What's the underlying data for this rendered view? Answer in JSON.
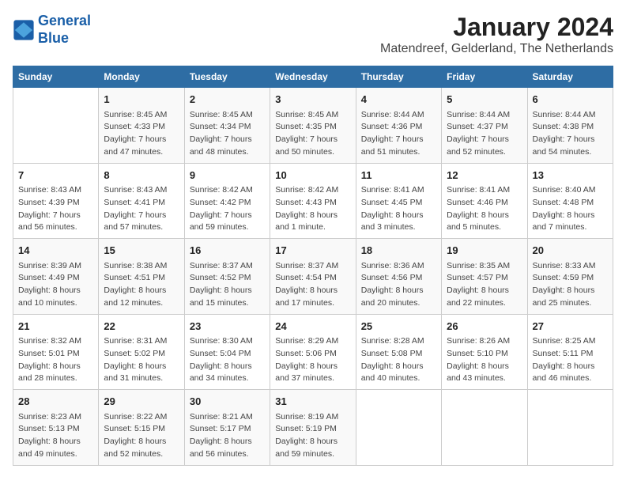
{
  "logo": {
    "line1": "General",
    "line2": "Blue"
  },
  "title": "January 2024",
  "subtitle": "Matendreef, Gelderland, The Netherlands",
  "days_of_week": [
    "Sunday",
    "Monday",
    "Tuesday",
    "Wednesday",
    "Thursday",
    "Friday",
    "Saturday"
  ],
  "weeks": [
    [
      {
        "day": "",
        "sunrise": "",
        "sunset": "",
        "daylight": ""
      },
      {
        "day": "1",
        "sunrise": "Sunrise: 8:45 AM",
        "sunset": "Sunset: 4:33 PM",
        "daylight": "Daylight: 7 hours and 47 minutes."
      },
      {
        "day": "2",
        "sunrise": "Sunrise: 8:45 AM",
        "sunset": "Sunset: 4:34 PM",
        "daylight": "Daylight: 7 hours and 48 minutes."
      },
      {
        "day": "3",
        "sunrise": "Sunrise: 8:45 AM",
        "sunset": "Sunset: 4:35 PM",
        "daylight": "Daylight: 7 hours and 50 minutes."
      },
      {
        "day": "4",
        "sunrise": "Sunrise: 8:44 AM",
        "sunset": "Sunset: 4:36 PM",
        "daylight": "Daylight: 7 hours and 51 minutes."
      },
      {
        "day": "5",
        "sunrise": "Sunrise: 8:44 AM",
        "sunset": "Sunset: 4:37 PM",
        "daylight": "Daylight: 7 hours and 52 minutes."
      },
      {
        "day": "6",
        "sunrise": "Sunrise: 8:44 AM",
        "sunset": "Sunset: 4:38 PM",
        "daylight": "Daylight: 7 hours and 54 minutes."
      }
    ],
    [
      {
        "day": "7",
        "sunrise": "Sunrise: 8:43 AM",
        "sunset": "Sunset: 4:39 PM",
        "daylight": "Daylight: 7 hours and 56 minutes."
      },
      {
        "day": "8",
        "sunrise": "Sunrise: 8:43 AM",
        "sunset": "Sunset: 4:41 PM",
        "daylight": "Daylight: 7 hours and 57 minutes."
      },
      {
        "day": "9",
        "sunrise": "Sunrise: 8:42 AM",
        "sunset": "Sunset: 4:42 PM",
        "daylight": "Daylight: 7 hours and 59 minutes."
      },
      {
        "day": "10",
        "sunrise": "Sunrise: 8:42 AM",
        "sunset": "Sunset: 4:43 PM",
        "daylight": "Daylight: 8 hours and 1 minute."
      },
      {
        "day": "11",
        "sunrise": "Sunrise: 8:41 AM",
        "sunset": "Sunset: 4:45 PM",
        "daylight": "Daylight: 8 hours and 3 minutes."
      },
      {
        "day": "12",
        "sunrise": "Sunrise: 8:41 AM",
        "sunset": "Sunset: 4:46 PM",
        "daylight": "Daylight: 8 hours and 5 minutes."
      },
      {
        "day": "13",
        "sunrise": "Sunrise: 8:40 AM",
        "sunset": "Sunset: 4:48 PM",
        "daylight": "Daylight: 8 hours and 7 minutes."
      }
    ],
    [
      {
        "day": "14",
        "sunrise": "Sunrise: 8:39 AM",
        "sunset": "Sunset: 4:49 PM",
        "daylight": "Daylight: 8 hours and 10 minutes."
      },
      {
        "day": "15",
        "sunrise": "Sunrise: 8:38 AM",
        "sunset": "Sunset: 4:51 PM",
        "daylight": "Daylight: 8 hours and 12 minutes."
      },
      {
        "day": "16",
        "sunrise": "Sunrise: 8:37 AM",
        "sunset": "Sunset: 4:52 PM",
        "daylight": "Daylight: 8 hours and 15 minutes."
      },
      {
        "day": "17",
        "sunrise": "Sunrise: 8:37 AM",
        "sunset": "Sunset: 4:54 PM",
        "daylight": "Daylight: 8 hours and 17 minutes."
      },
      {
        "day": "18",
        "sunrise": "Sunrise: 8:36 AM",
        "sunset": "Sunset: 4:56 PM",
        "daylight": "Daylight: 8 hours and 20 minutes."
      },
      {
        "day": "19",
        "sunrise": "Sunrise: 8:35 AM",
        "sunset": "Sunset: 4:57 PM",
        "daylight": "Daylight: 8 hours and 22 minutes."
      },
      {
        "day": "20",
        "sunrise": "Sunrise: 8:33 AM",
        "sunset": "Sunset: 4:59 PM",
        "daylight": "Daylight: 8 hours and 25 minutes."
      }
    ],
    [
      {
        "day": "21",
        "sunrise": "Sunrise: 8:32 AM",
        "sunset": "Sunset: 5:01 PM",
        "daylight": "Daylight: 8 hours and 28 minutes."
      },
      {
        "day": "22",
        "sunrise": "Sunrise: 8:31 AM",
        "sunset": "Sunset: 5:02 PM",
        "daylight": "Daylight: 8 hours and 31 minutes."
      },
      {
        "day": "23",
        "sunrise": "Sunrise: 8:30 AM",
        "sunset": "Sunset: 5:04 PM",
        "daylight": "Daylight: 8 hours and 34 minutes."
      },
      {
        "day": "24",
        "sunrise": "Sunrise: 8:29 AM",
        "sunset": "Sunset: 5:06 PM",
        "daylight": "Daylight: 8 hours and 37 minutes."
      },
      {
        "day": "25",
        "sunrise": "Sunrise: 8:28 AM",
        "sunset": "Sunset: 5:08 PM",
        "daylight": "Daylight: 8 hours and 40 minutes."
      },
      {
        "day": "26",
        "sunrise": "Sunrise: 8:26 AM",
        "sunset": "Sunset: 5:10 PM",
        "daylight": "Daylight: 8 hours and 43 minutes."
      },
      {
        "day": "27",
        "sunrise": "Sunrise: 8:25 AM",
        "sunset": "Sunset: 5:11 PM",
        "daylight": "Daylight: 8 hours and 46 minutes."
      }
    ],
    [
      {
        "day": "28",
        "sunrise": "Sunrise: 8:23 AM",
        "sunset": "Sunset: 5:13 PM",
        "daylight": "Daylight: 8 hours and 49 minutes."
      },
      {
        "day": "29",
        "sunrise": "Sunrise: 8:22 AM",
        "sunset": "Sunset: 5:15 PM",
        "daylight": "Daylight: 8 hours and 52 minutes."
      },
      {
        "day": "30",
        "sunrise": "Sunrise: 8:21 AM",
        "sunset": "Sunset: 5:17 PM",
        "daylight": "Daylight: 8 hours and 56 minutes."
      },
      {
        "day": "31",
        "sunrise": "Sunrise: 8:19 AM",
        "sunset": "Sunset: 5:19 PM",
        "daylight": "Daylight: 8 hours and 59 minutes."
      },
      {
        "day": "",
        "sunrise": "",
        "sunset": "",
        "daylight": ""
      },
      {
        "day": "",
        "sunrise": "",
        "sunset": "",
        "daylight": ""
      },
      {
        "day": "",
        "sunrise": "",
        "sunset": "",
        "daylight": ""
      }
    ]
  ]
}
